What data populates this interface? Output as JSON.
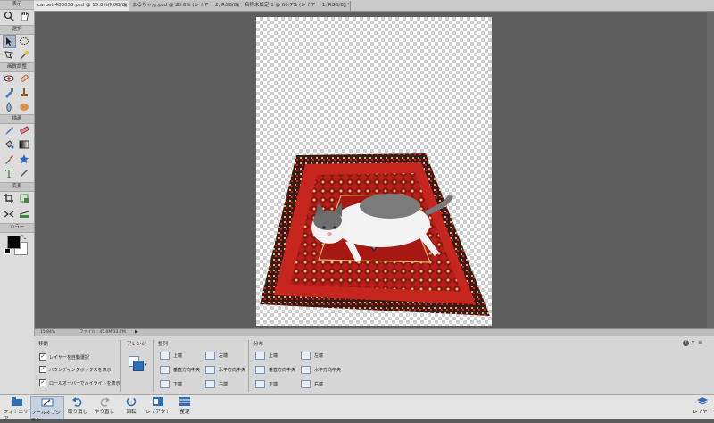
{
  "toolbox": {
    "sections": {
      "view": "表示",
      "select": "選択",
      "enhance": "画質調整",
      "draw": "描画",
      "modify": "変更",
      "color": "カラー"
    }
  },
  "tabs": [
    {
      "label": "carpet-483055.psd @ 15.8%(RGB/8) *",
      "active": true
    },
    {
      "label": "まるちゃん.psd @ 20.8% (レイヤー 2, RGB/8) *",
      "active": false
    },
    {
      "label": "名称未設定 1 @ 66.7% (レイヤー 1, RGB/8) *",
      "active": false
    }
  ],
  "status": {
    "zoom": "15.84%",
    "file": "ファイル : 45.0M/33.7M"
  },
  "options": {
    "move_title": "移動",
    "auto_select": "レイヤーを自動選択",
    "show_bounding": "バウンディングボックスを表示",
    "show_highlight": "ロールオーバーでハイライトを表示",
    "arrange_title": "アレンジ",
    "align_title": "整列",
    "align": [
      "上端",
      "垂直方向中央",
      "下端",
      "左端",
      "水平方向中央",
      "右端"
    ],
    "distribute_title": "分布",
    "distribute": [
      "上端",
      "垂直方向中央",
      "下端",
      "左端",
      "水平方向中央",
      "右端"
    ]
  },
  "taskbar": {
    "photo_area": "フォトエリア",
    "tool_options": "ツールオプション",
    "undo": "取り消し",
    "redo": "やり直し",
    "rotate": "回転",
    "layout": "レイアウト",
    "organizer": "整理",
    "layers": "レイヤー"
  },
  "colors": {
    "foreground": "#000000",
    "background": "#ffffff",
    "accent": "#2f6db5"
  }
}
